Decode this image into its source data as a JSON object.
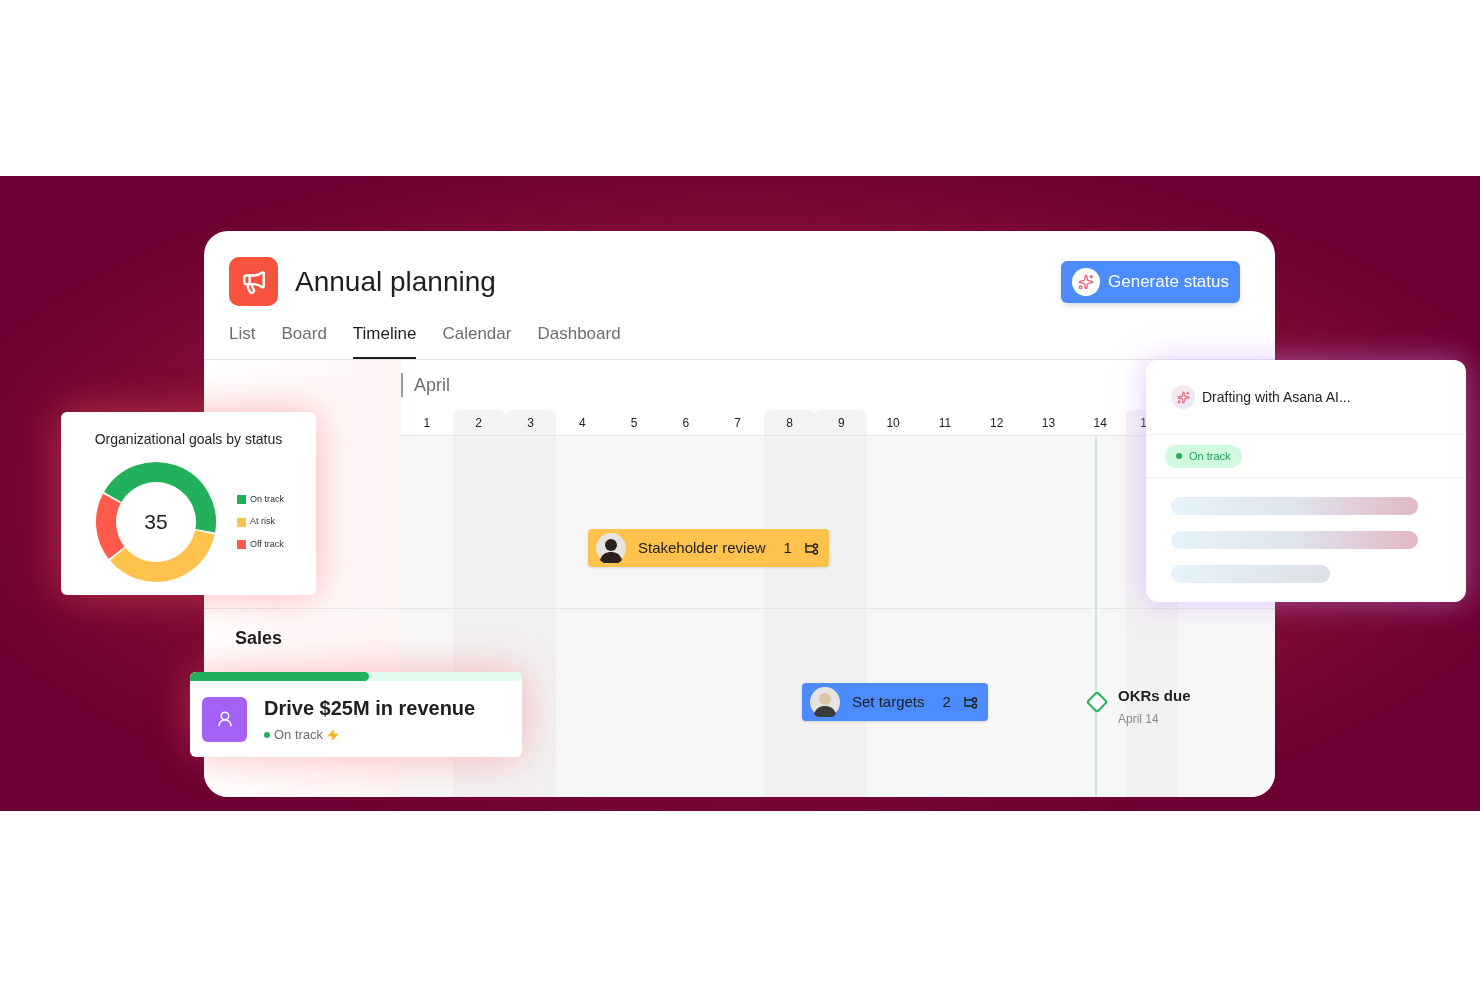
{
  "project": {
    "title": "Annual planning",
    "action": "Generate status"
  },
  "tabs": [
    {
      "label": "List",
      "selected": false
    },
    {
      "label": "Board",
      "selected": false
    },
    {
      "label": "Timeline",
      "selected": true
    },
    {
      "label": "Calendar",
      "selected": false
    },
    {
      "label": "Dashboard",
      "selected": false
    }
  ],
  "timeline": {
    "month": "April",
    "days": [
      "1",
      "2",
      "3",
      "4",
      "5",
      "6",
      "7",
      "8",
      "9",
      "10",
      "11",
      "12",
      "13",
      "14",
      "1"
    ],
    "section": "Sales"
  },
  "tasks": [
    {
      "name": "Stakeholder review",
      "count": "1",
      "color": "#ffc34d"
    },
    {
      "name": "Set targets",
      "count": "2",
      "color": "#4c8cff"
    }
  ],
  "milestone": {
    "name": "OKRs due",
    "date": "April 14"
  },
  "goals_widget": {
    "title": "Organizational goals by status",
    "total": "35",
    "legend": [
      {
        "label": "On track",
        "color": "#22b15a"
      },
      {
        "label": "At risk",
        "color": "#ffc34d"
      },
      {
        "label": "Off track",
        "color": "#ff5a4a"
      }
    ]
  },
  "goal_card": {
    "title": "Drive $25M in revenue",
    "status": "On track",
    "level": 0.54
  },
  "ai_panel": {
    "title": "Drafting with Asana AI...",
    "status": "On track"
  }
}
